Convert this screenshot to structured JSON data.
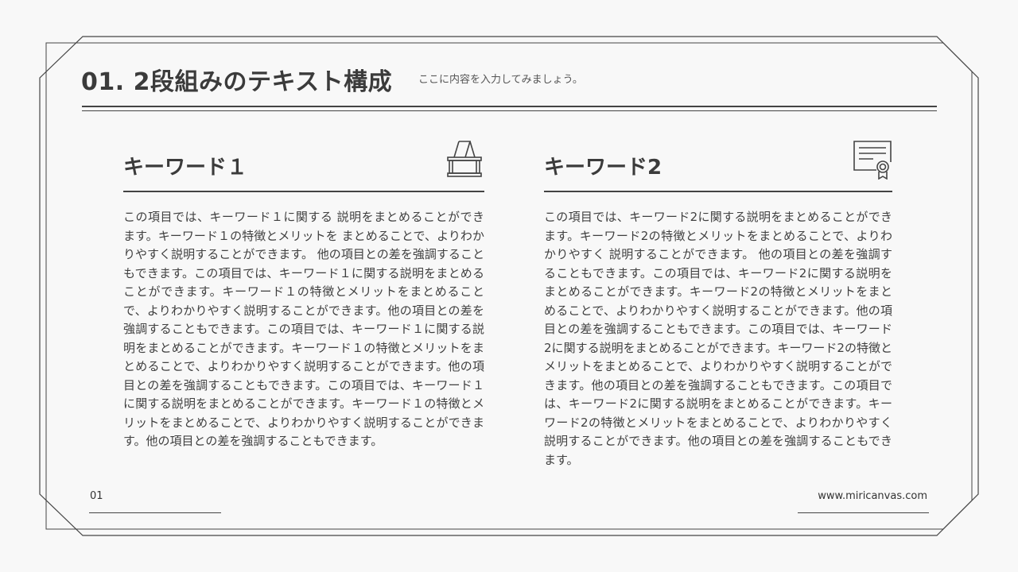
{
  "header": {
    "title": "01. 2段組みのテキスト構成",
    "subtitle": "ここに内容を入力してみましょう。"
  },
  "columns": [
    {
      "title": "キーワード１",
      "icon": "binder-clip-icon",
      "body": "この項目では、キーワード１に関する 説明をまとめることができます。キーワード１の特徴とメリットを まとめることで、よりわかりやすく説明することができます。 他の項目との差を強調することもできます。この項目では、キーワード１に関する説明をまとめることができます。キーワード１の特徴とメリットをまとめることで、よりわかりやすく説明することができます。他の項目との差を強調することもできます。この項目では、キーワード１に関する説明をまとめることができます。キーワード１の特徴とメリットをまとめることで、よりわかりやすく説明することができます。他の項目との差を強調することもできます。この項目では、キーワード１に関する説明をまとめることができます。キーワード１の特徴とメリットをまとめることで、よりわかりやすく説明することができます。他の項目との差を強調することもできます。"
    },
    {
      "title": "キーワード2",
      "icon": "certificate-icon",
      "body": "この項目では、キーワード2に関する説明をまとめることができます。キーワード2の特徴とメリットをまとめることで、よりわかりやすく 説明することができます。 他の項目との差を強調することもできます。この項目では、キーワード2に関する説明をまとめることができます。キーワード2の特徴とメリットをまとめることで、よりわかりやすく説明することができます。他の項目との差を強調することもできます。この項目では、キーワード2に関する説明をまとめることができます。キーワード2の特徴とメリットをまとめることで、よりわかりやすく説明することができます。他の項目との差を強調することもできます。この項目では、キーワード2に関する説明をまとめることができます。キーワード2の特徴とメリットをまとめることで、よりわかりやすく説明することができます。他の項目との差を強調することもできます。"
    }
  ],
  "footer": {
    "page_number": "01",
    "url": "www.miricanvas.com"
  }
}
